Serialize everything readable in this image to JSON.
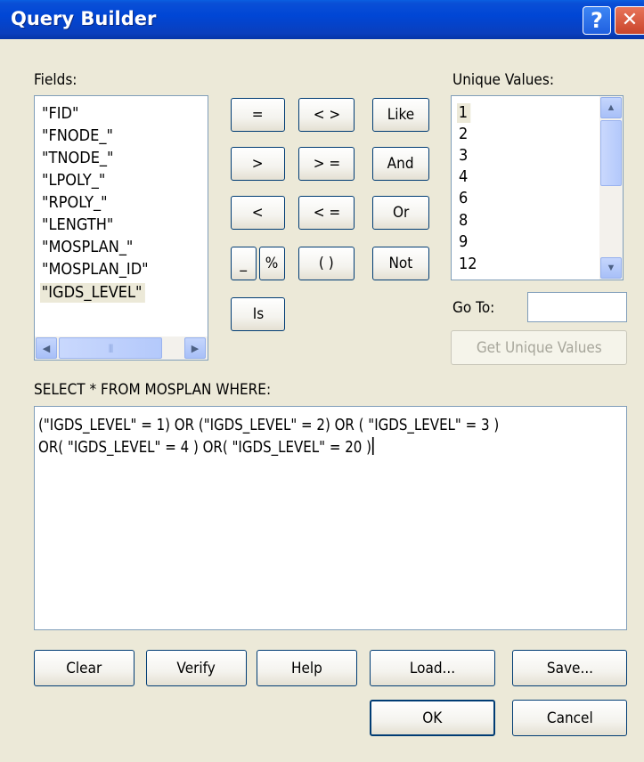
{
  "window": {
    "title": "Query Builder",
    "help_glyph": "?",
    "close_glyph": "✕"
  },
  "fields": {
    "label": "Fields:",
    "items": [
      "\"FID\"",
      "\"FNODE_\"",
      "\"TNODE_\"",
      "\"LPOLY_\"",
      "\"RPOLY_\"",
      "\"LENGTH\"",
      "\"MOSPLAN_\"",
      "\"MOSPLAN_ID\"",
      "\"IGDS_LEVEL\""
    ],
    "selected_index": 8,
    "scroll_left": "◀",
    "scroll_right": "▶",
    "grip": "|||"
  },
  "operators": {
    "eq": "=",
    "neq": "< >",
    "like": "Like",
    "gt": ">",
    "gte": "> =",
    "and": "And",
    "lt": "<",
    "lte": "< =",
    "or": "Or",
    "underscore": "_",
    "percent": "%",
    "parens": "( )",
    "not": "Not",
    "is": "Is"
  },
  "unique_values": {
    "label": "Unique Values:",
    "items": [
      "1",
      "2",
      "3",
      "4",
      "6",
      "8",
      "9",
      "12"
    ],
    "selected_index": 0,
    "scroll_up": "▲",
    "scroll_down": "▼",
    "goto_label": "Go To:",
    "goto_value": "",
    "get_button": "Get Unique Values"
  },
  "query": {
    "label": "SELECT * FROM MOSPLAN WHERE:",
    "lines": [
      "(\"IGDS_LEVEL\" = 1) OR (\"IGDS_LEVEL\" = 2) OR ( \"IGDS_LEVEL\" = 3 )",
      "OR( \"IGDS_LEVEL\" = 4 ) OR( \"IGDS_LEVEL\" = 20 )"
    ]
  },
  "buttons": {
    "clear": "Clear",
    "verify": "Verify",
    "help": "Help",
    "load": "Load...",
    "save": "Save...",
    "ok": "OK",
    "cancel": "Cancel"
  },
  "colors": {
    "titlebar": "#0046d5",
    "dialog_bg": "#ece9d8",
    "button_border": "#003c74"
  }
}
